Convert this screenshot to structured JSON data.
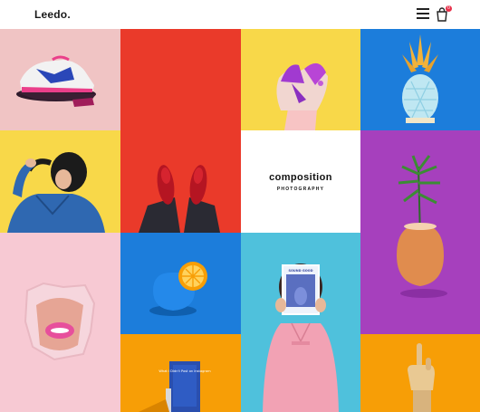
{
  "header": {
    "logo": "Leedo.",
    "cart_count": "0",
    "icons": [
      "hamburger-menu-icon",
      "shopping-bag-icon"
    ]
  },
  "colors": {
    "pink_tile": "#f0c4c4",
    "yellow_tile": "#f8d849",
    "red_tile": "#ea3a2a",
    "blue_tile": "#1c7ddb",
    "purple_tile": "#a640bd",
    "light_pink_tile": "#f7c9d3",
    "cyan_tile": "#4fc1dc",
    "orange_tile": "#f79e06",
    "accent_highlight": "#f6d54a",
    "badge": "#e8304a"
  },
  "grid": {
    "center_tile": {
      "title": "composition",
      "subtitle": "PHOTOGRAPHY"
    },
    "photos": [
      {
        "name": "sneaker-photo"
      },
      {
        "name": "red-shoes-photo"
      },
      {
        "name": "painted-hand-photo"
      },
      {
        "name": "pineapple-photo"
      },
      {
        "name": "hair-girl-photo"
      },
      {
        "name": "egg-plant-photo"
      },
      {
        "name": "lips-photo"
      },
      {
        "name": "orange-photo"
      },
      {
        "name": "magazine-woman-photo"
      },
      {
        "name": "book-photo"
      },
      {
        "name": "wooden-hand-photo"
      }
    ]
  },
  "magazine": {
    "cover_title": "SOUND GOOD"
  },
  "book": {
    "cover_text": "What I Didn't Post on Instagram"
  }
}
